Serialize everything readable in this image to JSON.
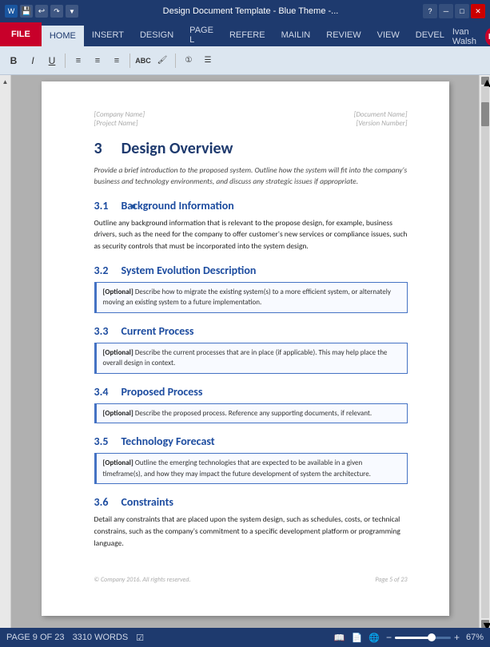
{
  "titlebar": {
    "title": "Design Document Template - Blue Theme -...",
    "help": "?",
    "minimize": "─",
    "maximize": "□",
    "close": "✕"
  },
  "toolbar_icons": {
    "save": "💾",
    "undo": "↩",
    "redo": "↪",
    "spell": "ABC"
  },
  "ribbon": {
    "tabs": [
      "FILE",
      "HOME",
      "INSERT",
      "DESIGN",
      "PAGE L",
      "REFERE",
      "MAILIN",
      "REVIEW",
      "VIEW",
      "DEVEL"
    ],
    "user": "Ivan Walsh",
    "user_initial": "K"
  },
  "document": {
    "header_left_line1": "[Company Name]",
    "header_left_line2": "[Project Name]",
    "header_right_line1": "[Document Name]",
    "header_right_line2": "[Version Number]",
    "section3": {
      "number": "3",
      "title": "Design Overview",
      "intro": "Provide a brief introduction to the proposed system. Outline how the system will fit into the company's business and technology environments, and discuss any strategic issues if appropriate."
    },
    "section3_1": {
      "number": "3.1",
      "title": "Background Information",
      "body": "Outline any background information that is relevant to the propose design, for example, business drivers, such as the need for the company to offer customer's new services or compliance issues, such as security controls that must be incorporated into the system design."
    },
    "section3_2": {
      "number": "3.2",
      "title": "System Evolution Description",
      "optional_text": "Describe how to migrate the existing system(s) to a more efficient system, or alternately moving an existing system to a future implementation."
    },
    "section3_3": {
      "number": "3.3",
      "title": "Current Process",
      "optional_text": "Describe the current processes that are in place (if applicable). This may help place the overall design in context."
    },
    "section3_4": {
      "number": "3.4",
      "title": "Proposed Process",
      "optional_text": "Describe the proposed process. Reference any supporting documents, if relevant."
    },
    "section3_5": {
      "number": "3.5",
      "title": "Technology Forecast",
      "optional_text": "Outline the emerging technologies that are expected to be available in a given timeframe(s), and how they may impact the future development of system the architecture."
    },
    "section3_6": {
      "number": "3.6",
      "title": "Constraints",
      "body": "Detail any constraints that are placed upon the system design, such as schedules, costs, or technical constrains, such as the company's commitment to a specific development platform or programming language."
    },
    "footer_left": "© Company 2016. All rights reserved.",
    "footer_right": "Page 5 of 23"
  },
  "statusbar": {
    "page_info": "PAGE 9 OF 23",
    "word_count": "3310 WORDS",
    "zoom_percent": "67%"
  },
  "optional_label": "[Optional]"
}
